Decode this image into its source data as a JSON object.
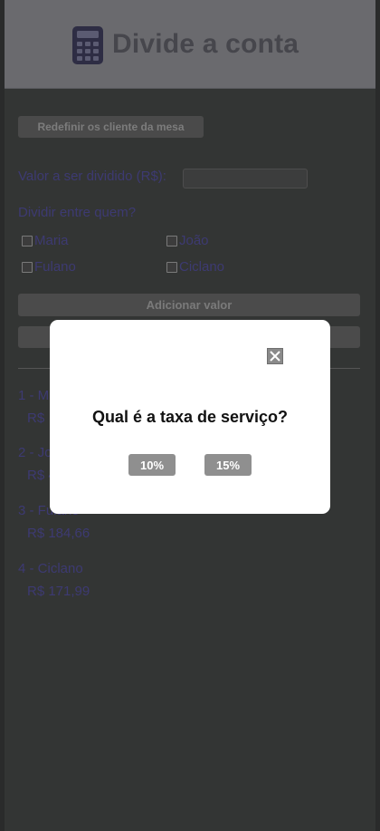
{
  "header": {
    "title": "Divide a conta",
    "icon": "calculator-icon"
  },
  "form": {
    "reset_label": "Redefinir os cliente da mesa",
    "value_label": "Valor a ser dividido (R$):",
    "value_input": "",
    "divide_label": "Dividir entre quem?",
    "people": [
      {
        "name": "Maria",
        "checked": false
      },
      {
        "name": "João",
        "checked": false
      },
      {
        "name": "Fulano",
        "checked": false
      },
      {
        "name": "Ciclano",
        "checked": false
      }
    ],
    "add_label": "Adicionar valor"
  },
  "results": [
    {
      "label": "1 - M",
      "amount": "R$"
    },
    {
      "label": "2 - Jo",
      "amount": "R$ 4"
    },
    {
      "label": "3 - Fulano",
      "amount": "R$ 184,66"
    },
    {
      "label": "4 - Ciclano",
      "amount": "R$ 171,99"
    }
  ],
  "modal": {
    "question": "Qual é a taxa de serviço?",
    "options": [
      "10%",
      "15%"
    ],
    "close_icon": "close-icon"
  },
  "colors": {
    "background": "#333534",
    "header": "#6a6a6e",
    "text_dim": "#3d3a72",
    "modal_button": "#8f8f8f"
  }
}
